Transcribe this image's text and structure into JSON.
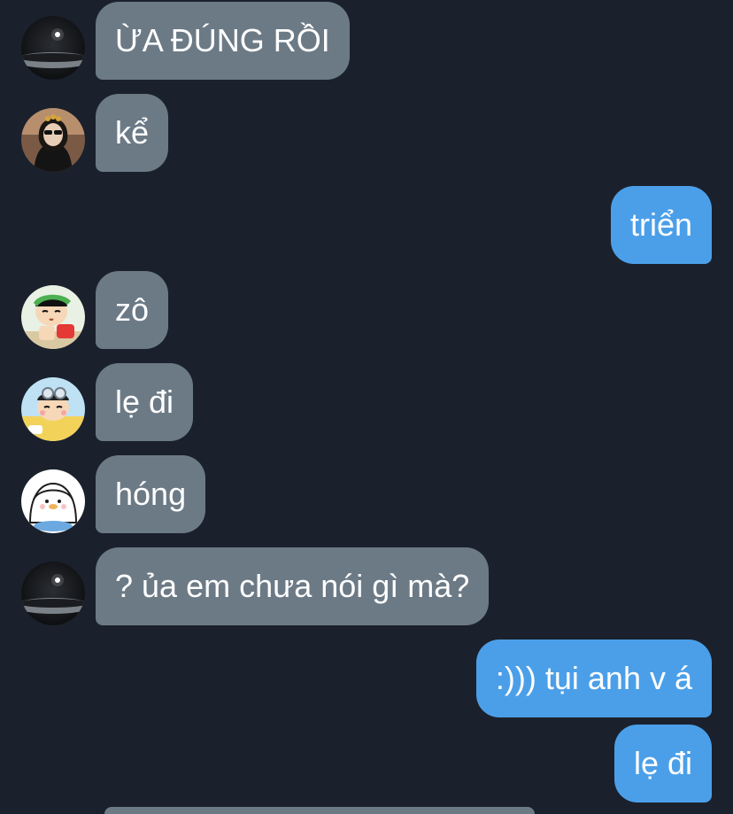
{
  "chat": {
    "messages": [
      {
        "side": "incoming",
        "avatar": "planet-avatar",
        "text": "ỪA ĐÚNG RỒI"
      },
      {
        "side": "incoming",
        "avatar": "girl-sunglasses-avatar",
        "text": "kể"
      },
      {
        "side": "outgoing",
        "text": "triển"
      },
      {
        "side": "incoming",
        "avatar": "cartoon-boy-green-hat-avatar",
        "text": "zô"
      },
      {
        "side": "incoming",
        "avatar": "cartoon-boy-goggles-avatar",
        "text": "lẹ đi"
      },
      {
        "side": "incoming",
        "avatar": "penguin-avatar",
        "text": "hóng"
      },
      {
        "side": "incoming",
        "avatar": "planet-avatar",
        "text": "? ủa em chưa nói gì mà?"
      },
      {
        "side": "outgoing",
        "text": ":))) tụi anh v á"
      },
      {
        "side": "outgoing",
        "text": "lẹ đi"
      }
    ]
  },
  "colors": {
    "background": "#1a212c",
    "incoming_bubble": "#6c7a86",
    "outgoing_bubble": "#4b9fe8",
    "text": "#ffffff"
  }
}
